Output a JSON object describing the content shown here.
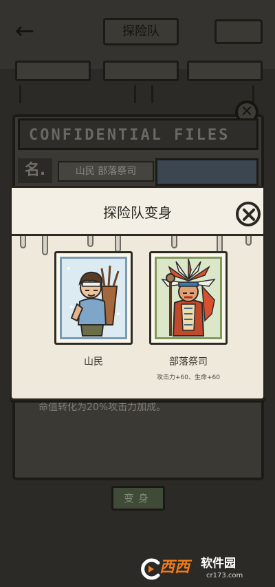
{
  "background": {
    "title": "探险队",
    "files_banner": "CONFIDENTIAL FILES",
    "name_tag": "名.",
    "name_value": "山民 部落祭司",
    "description": "命值转化为20%攻击力加成。",
    "transform_button": "变身"
  },
  "modal": {
    "title": "探险队变身",
    "options": [
      {
        "label": "山民",
        "bonus": ""
      },
      {
        "label": "部落祭司",
        "bonus": "攻击力+60、生命+60"
      }
    ]
  },
  "watermark": {
    "brand": "西西",
    "name": "软件园",
    "url": "cr173.com"
  },
  "colors": {
    "modal_bg": "#efe9dc",
    "card_border_blue": "#7a9bb2",
    "card_border_green": "#7e9a5c",
    "watermark_orange": "#f07a1a"
  }
}
